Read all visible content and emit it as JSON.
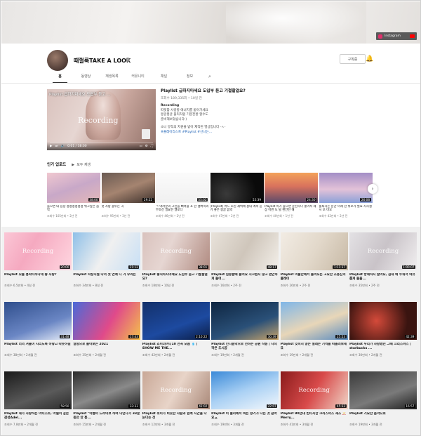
{
  "channel": {
    "name": "때껄룩TAKE A LOOK",
    "subscribe_label": "구독중",
    "social": "Instagram"
  },
  "tabs": [
    {
      "label": "홈",
      "active": true
    },
    {
      "label": "동영상"
    },
    {
      "label": "재생목록"
    },
    {
      "label": "커뮤니티"
    },
    {
      "label": "채널"
    },
    {
      "label": "정보"
    }
  ],
  "featured": {
    "player_title": "Playlist 급하지마세요 도입부 듣고 ...",
    "overlay": "Recording",
    "time": "0:01 / 38:00",
    "title": "Playlist 급하지마세요 도입부 듣고 기절할걸요?",
    "meta": "조회수 189,335회 • 10일 전",
    "rec_label": "Recording",
    "desc1": "따뜻함 사랑할 에너지를 받아가세요",
    "desc2": "몽글몽글 플리처럼 기분전환 할수도",
    "desc3": "준비해보았습니다:)",
    "desc4": "소니 뮤직의 지원을 받아 제작된 영상입니다 -ㅅ-",
    "tags": "#플레이리스트 #Playlist #신나는..."
  },
  "popular": {
    "heading": "인기 업로드",
    "play_all": "모두 재생",
    "items": [
      {
        "title": "들으면 내 심장 콩콩콩콩콩콩 뛰고싶은 음악",
        "meta": "조회수 105만회 • 2년 전",
        "dur": "38:00",
        "bg": "linear-gradient(160deg,#f0c8d0,#c8a8c8 50%,#e4b8b8)"
      },
      {
        "title": "첫 사랑 플루는 곡",
        "meta": "조회수 95만회 • 3년 전",
        "dur": "29:22",
        "bg": "linear-gradient(160deg,#6a5a52,#a58470 50%,#3c302b)"
      },
      {
        "title": "ㄱ 여러분의 고민을 뻐여줄 포 한 멤버끼리 무조건 필요한 멜로디",
        "meta": "조회수 46만회 • 2년 전",
        "dur": "55:02",
        "bg": "linear-gradient(#fbfbfb,#f0f0f0)"
      },
      {
        "title": "[Playlist] 어느 조린 새벽에 창대 에서 듣기 좋은 몽글 음악",
        "meta": "조회수 47만회 • 2년 전",
        "dur": "52:39",
        "bg": "radial-gradient(circle at 30% 70%,#3a3a3a,#0a0a0a 70%)"
      },
      {
        "title": "Playlist 이거 들으면 운전하다 좋아서 세상 어쩐 도 덜 편안한 해",
        "meta": "조회수 40만회 • 1년 전",
        "dur": "24:30",
        "bg": "linear-gradient(#f3a25a,#d9725d 45%,#5a4a6a)"
      },
      {
        "title": "출퇴하는 순간 이제 넌 위로가 필요 지하철 시 또 미오",
        "meta": "조회수 42만회 • 2년 전",
        "dur": "26:08",
        "bg": "linear-gradient(#a38ec6,#e3c2d8 55%,#8aa0d8)"
      }
    ]
  },
  "grid": [
    {
      "title": "Playlist 오늘 흥파티하다데 좋 사랑?",
      "meta": "조회수 6.5만회 • 4일 전",
      "dur": "20:00",
      "bg": "linear-gradient(120deg,#fbc7d6,#f5a9c0 40%,#ffd6e0)",
      "rec": "Recording"
    },
    {
      "title": "Playlist 학창시절 나의 첫 연애 니 거 우리는",
      "meta": "조회수 34만회 • 8일 전",
      "dur": "21:12",
      "bg": "linear-gradient(120deg,#8fc0e8,#f0f0f0 50%,#c7dff5)",
      "rec": ""
    },
    {
      "title": "Playlist 좋직하지마세요 도입부 듣고 기절할걸요?",
      "meta": "조회수 18만회 • 10일 전",
      "dur": "38:01",
      "bg": "linear-gradient(115deg,#d9c2bd,#e6d6d2 40%,#b08a80)",
      "rec": "Recording"
    },
    {
      "title": "Playlist 집중할때 들어요 시끄럽지 않고 편안하게 들어...",
      "meta": "조회수 16만회 • 2주 전",
      "dur": "48:17",
      "bg": "linear-gradient(120deg,#e8e2da,#cfc6bb 50%,#f3efe9)",
      "rec": ""
    },
    {
      "title": "Playlist 이불안에서 들려오는 고요한 조용진의 플레이",
      "meta": "조회수 26만회 • 2주 전",
      "dur": "1:11:37",
      "bg": "linear-gradient(120deg,#f2ece4,#e2d8ca 50%,#c7b9a5)",
      "rec": ""
    },
    {
      "title": "Playlist 방해하지 말아요, 침대 에 누워서 여유롭게 들을...",
      "meta": "조회수 35만회 • 2주 전",
      "dur": "1:00:07",
      "bg": "linear-gradient(120deg,#e3e1e4,#c9c3c8 50%,#f1eff0)",
      "rec": "Recording"
    },
    {
      "title": "Playlist 너의 겨울이 시리도록 하얗고 따듯하길",
      "meta": "조회수 38만회 • 2개월 전",
      "dur": "31:48",
      "bg": "linear-gradient(160deg,#2f4e8c,#6a86c4 60%,#e8eef8)",
      "rec": ""
    },
    {
      "title": "알송으로 돌아보는 2021",
      "meta": "조회수 35만회 • 2개월 전",
      "dur": "17:43",
      "bg": "linear-gradient(120deg,#4b6ad8,#e04a8a 55%,#f4c24a)",
      "rec": ""
    },
    {
      "title": "Playlist 쇼미더머니10 전곡 모음 💧 | SHOW ME THE...",
      "meta": "조회수 42만회 • 2개월 전",
      "dur": "2:10:22",
      "bg": "linear-gradient(160deg,#13306a,#1d4aa0 60%,#0b1c44)",
      "rec": ""
    },
    {
      "title": "Playlist 인디음악으로 전하는 공원 작동 | 나의 작은 도시공",
      "meta": "조회수 19만회 • 2개월 전",
      "dur": "30:39",
      "bg": "linear-gradient(160deg,#0e2540,#2a5078 60%,#c8a46a)",
      "rec": ""
    },
    {
      "title": "Playlist 잊히지 않는 설레는 기억을 떠올려보세요",
      "meta": "조회수 19만회 • 2개월 전",
      "dur": "25:53",
      "bg": "linear-gradient(160deg,#7fb6e8,#e8d6b8 55%,#5a8cc0)",
      "rec": ""
    },
    {
      "title": "Playlist 우리가 사랑했던 그때 크리스마스 | starbucks ...",
      "meta": "조회수 30만회 • 2개월 전",
      "dur": "42:39",
      "bg": "radial-gradient(circle at 40% 50%,#d44a3a,#3a1410 70%)",
      "rec": ""
    },
    {
      "title": "Playlist 내가 사랑하는 아티스트, 아델의 깊은 감성Adel...",
      "meta": "조회수 7.8만회 • 2개월 전",
      "dur": "58:50",
      "bg": "linear-gradient(160deg,#1a1a1a,#5a5a5a 60%,#2a2a2a)",
      "rec": ""
    },
    {
      "title": "Playlist \"아름이 드라이브 하며 나던다가 33분 동안 안 흥...",
      "meta": "조회수 15만회 • 2개월 전",
      "dur": "33:33",
      "bg": "linear-gradient(160deg,#2c2c2c,#8a8a8a 55%,#1b1b1b)",
      "rec": ""
    },
    {
      "title": "Playlist 취미가 비슷한 사람과 함께 시간을 나눈다는 것",
      "meta": "조회수 12만회 • 3개월 전",
      "dur": "42:02",
      "bg": "linear-gradient(120deg,#c9a897,#e8d4c8 50%,#a98878)",
      "rec": "Recording"
    },
    {
      "title": "Playlist 이 플리에서 비는 향기가 나는 것 같아요☁",
      "meta": "조회수 19만회 • 3개월 전",
      "dur": "22:07",
      "bg": "linear-gradient(160deg,#3b8ad8,#a9d0f4 50%,#f4f8fc)",
      "rec": ""
    },
    {
      "title": "Playlist 90년대 빈티지한 크리스마스 재즈 🎅 Merry...",
      "meta": "조회수 41만회 • 3개월 전",
      "dur": "45:33",
      "bg": "linear-gradient(120deg,#8a1c1c,#d84a4a 50%,#f0d6c8)",
      "rec": "Recording"
    },
    {
      "title": "Playlist 기묘한 음악으로",
      "meta": "조회수 19만회 • 3개월 전",
      "dur": "16:57",
      "bg": "linear-gradient(160deg,#3a3a3a,#7a7a7a 60%,#1e1e1e)",
      "rec": ""
    }
  ]
}
